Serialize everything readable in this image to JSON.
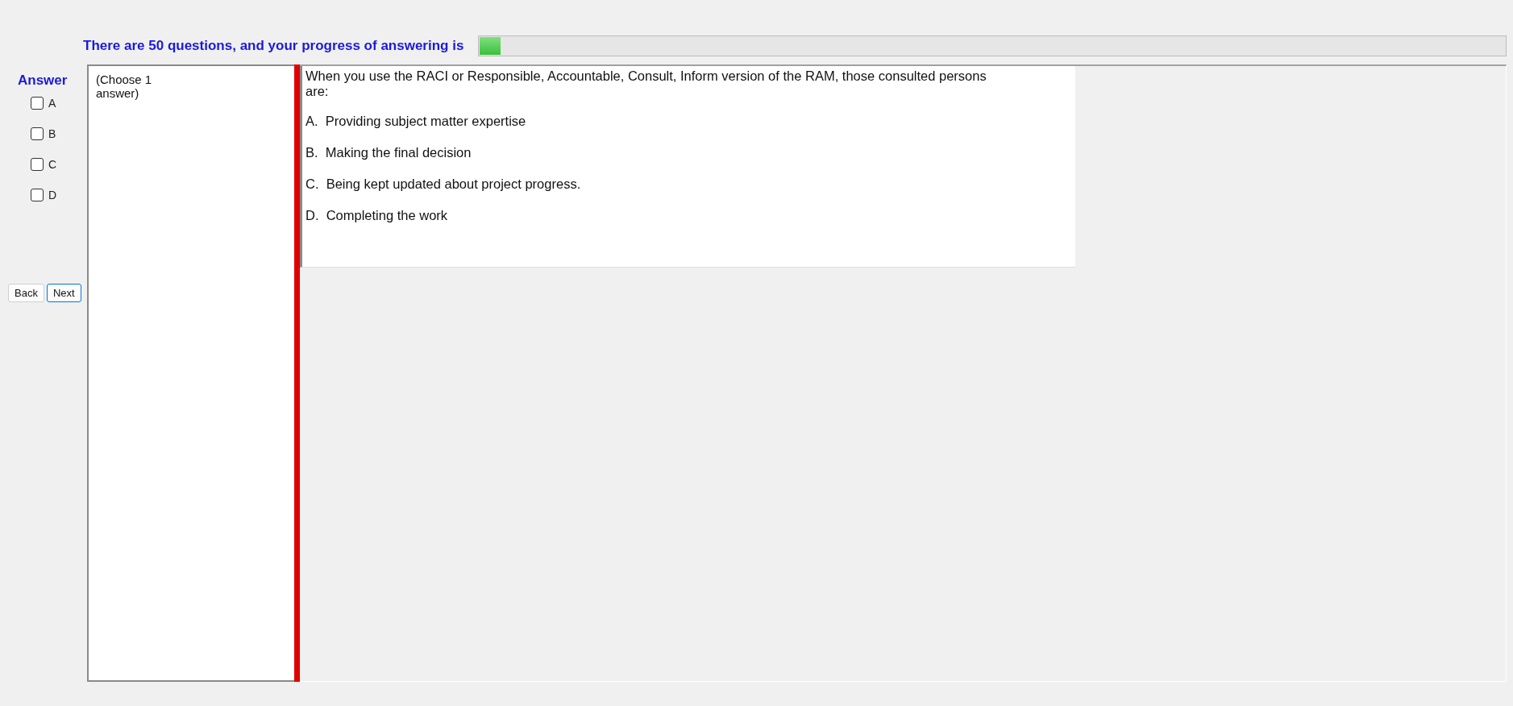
{
  "progress": {
    "label": "There are 50 questions, and your progress of answering is",
    "level": 0.02
  },
  "answer_title": "Answer",
  "options": [
    {
      "label": "A",
      "checked": false
    },
    {
      "label": "B",
      "checked": false
    },
    {
      "label": "C",
      "checked": false
    },
    {
      "label": "D",
      "checked": false
    }
  ],
  "buttons": [
    {
      "label": "Back",
      "focused": false
    },
    {
      "label": "Next",
      "focused": true
    }
  ],
  "instruction": "(Choose 1 answer)",
  "question": {
    "text": "When you use the RACI or Responsible, Accountable, Consult, Inform version of the RAM, those consulted persons are:",
    "choices": [
      "A.  Providing subject matter expertise",
      "B.  Making the final decision",
      "C.  Being kept updated about project progress.",
      "D.  Completing the work"
    ]
  }
}
